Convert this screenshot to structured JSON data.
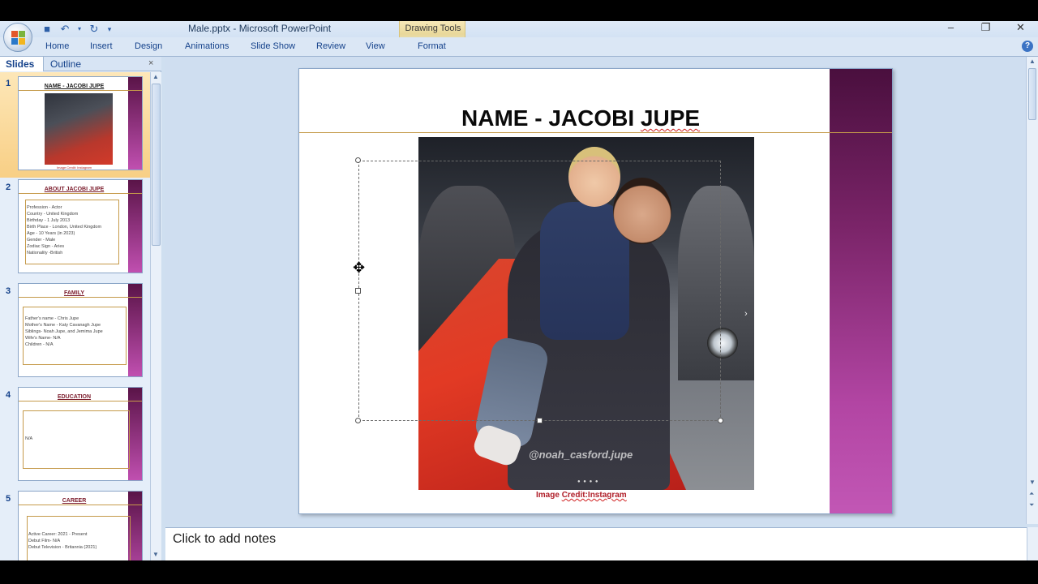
{
  "window": {
    "title": "Male.pptx - Microsoft PowerPoint",
    "context_tab_group": "Drawing Tools",
    "controls": [
      "minimize-icon",
      "restore-icon",
      "close-icon"
    ]
  },
  "quick_access": [
    "save-icon",
    "undo-icon",
    "undo-dropdown-icon",
    "redo-icon",
    "customize-icon"
  ],
  "ribbon": {
    "tabs": [
      "Home",
      "Insert",
      "Design",
      "Animations",
      "Slide Show",
      "Review",
      "View",
      "Format"
    ]
  },
  "left_pane": {
    "tabs": [
      "Slides",
      "Outline"
    ],
    "close": "×",
    "thumbnails": [
      {
        "num": "1",
        "title": "NAME - JACOBI JUPE",
        "lines": [],
        "caption": "Image Credit: Instagram"
      },
      {
        "num": "2",
        "title": "ABOUT JACOBI JUPE",
        "lines": [
          "Profession - Actor",
          "Country - United Kingdom",
          "Birthday - 1 July 2013",
          "Birth Place - London, United Kingdom",
          "Age - 10 Years (in 2023)",
          "Gender - Male",
          "Zodiac Sign - Aries",
          "Nationality -British"
        ]
      },
      {
        "num": "3",
        "title": "FAMILY",
        "lines": [
          "Father's name - Chris Jupe",
          "Mother's Name - Katy Cavanagh Jupe",
          "Siblings- Noah Jupe, and Jemima Jupe",
          "Wife's Name- N/A",
          "Children - N/A"
        ]
      },
      {
        "num": "4",
        "title": "EDUCATION",
        "lines": [
          "N/A"
        ]
      },
      {
        "num": "5",
        "title": "CAREER",
        "lines": [
          "Active Career: 2021 - Present",
          "Debut Film- N/A",
          "Debut Television - Britannia (2021)"
        ]
      }
    ]
  },
  "slide": {
    "title_prefix": "NAME - JACOBI ",
    "title_suffix": "JUPE",
    "photo_watermark": "@noah_casford.jupe",
    "photo_dots": "● ● ● ●",
    "photo_next": "›",
    "credit_prefix": "Image ",
    "credit_suffix": "Credit:Instagram"
  },
  "notes": {
    "placeholder": "Click to add notes"
  },
  "colors": {
    "title_text": "#0a0a0a",
    "accent_band": "#7a2468",
    "credit_text": "#b0202a",
    "ribbon_text": "#15428b"
  }
}
